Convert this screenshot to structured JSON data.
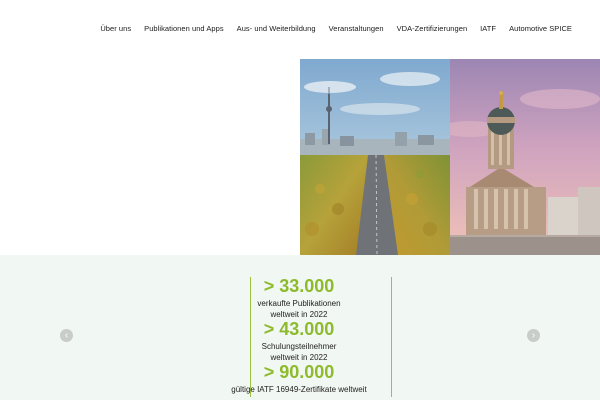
{
  "nav": {
    "items": [
      "Über uns",
      "Publikationen und Apps",
      "Aus- und Weiterbildung",
      "Veranstaltungen",
      "VDA-Zertifizierungen",
      "IATF",
      "Automotive SPICE"
    ]
  },
  "stats": {
    "items": [
      {
        "number": "> 33.000",
        "line1": "verkaufte Publikationen",
        "line2": "weltweit in 2022"
      },
      {
        "number": "> 43.000",
        "line1": "Schulungsteilnehmer",
        "line2": "weltweit in 2022"
      },
      {
        "number": "> 90.000",
        "line1": "gültige IATF 16949-Zertifikate weltweit",
        "line2": ""
      }
    ]
  },
  "slider": {
    "prev_icon": "chevron-left-icon",
    "next_icon": "chevron-right-icon"
  },
  "colors": {
    "accent_green": "#8dbb2c",
    "band_bg": "#f1f7f3"
  }
}
